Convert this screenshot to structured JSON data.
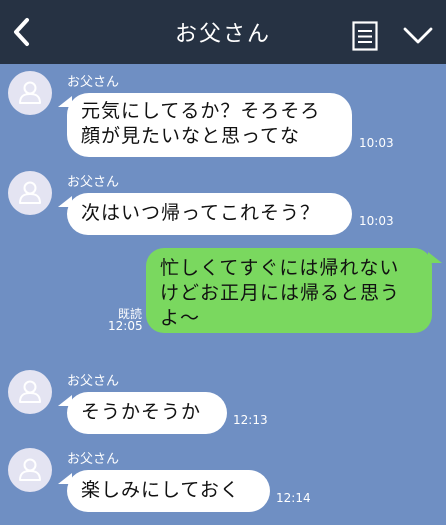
{
  "header": {
    "title": "お父さん"
  },
  "messages": [
    {
      "sender": "お父さん",
      "lines": [
        "元気にしてるか？そろそろ",
        "顔が見たいなと思ってな"
      ],
      "time": "10:03"
    },
    {
      "sender": "お父さん",
      "lines": [
        "次はいつ帰ってこれそう？"
      ],
      "time": "10:03"
    },
    {
      "lines": [
        "忙しくてすぐには帰れない",
        "けどお正月には帰ると思う",
        "よ〜"
      ],
      "read": "既読",
      "time": "12:05"
    },
    {
      "sender": "お父さん",
      "lines": [
        "そうかそうか"
      ],
      "time": "12:13"
    },
    {
      "sender": "お父さん",
      "lines": [
        "楽しみにしておく"
      ],
      "time": "12:14"
    }
  ],
  "colors": {
    "background": "#6f8fc3",
    "header": "#263243",
    "outgoing_bubble": "#7ad85f",
    "incoming_bubble": "#ffffff",
    "avatar": "#e4e4f2"
  },
  "icons": [
    "back-chevron-icon",
    "notes-icon",
    "chevron-down-icon",
    "person-icon"
  ]
}
